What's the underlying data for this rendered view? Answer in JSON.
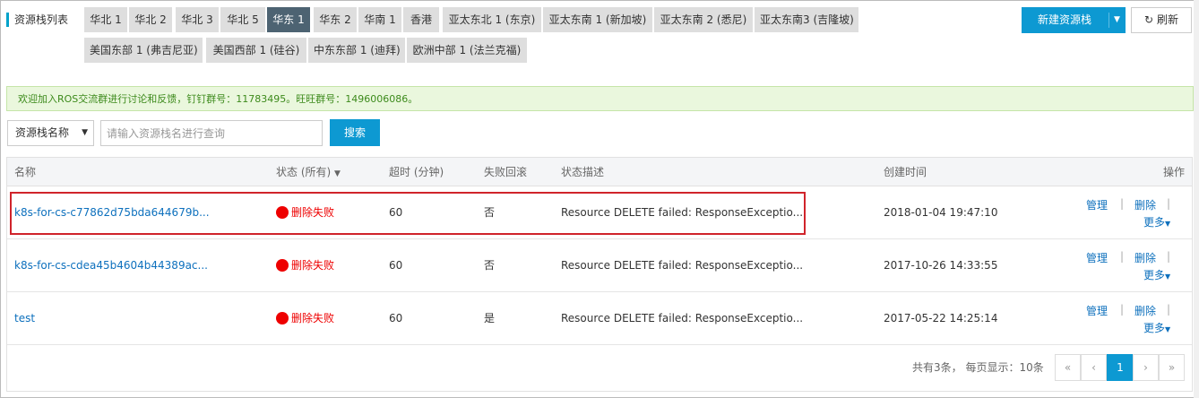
{
  "header": {
    "title": "资源栈列表"
  },
  "regions": [
    {
      "label": "华北 1",
      "active": false
    },
    {
      "label": "华北 2",
      "active": false
    },
    {
      "label": "华北 3",
      "active": false
    },
    {
      "label": "华北 5",
      "active": false
    },
    {
      "label": "华东 1",
      "active": true
    },
    {
      "label": "华东 2",
      "active": false
    },
    {
      "label": "华南 1",
      "active": false
    },
    {
      "label": "香港",
      "active": false
    },
    {
      "label": "亚太东北 1 (东京)",
      "active": false
    },
    {
      "label": "亚太东南 1 (新加坡)",
      "active": false
    },
    {
      "label": "亚太东南 2 (悉尼)",
      "active": false
    },
    {
      "label": "亚太东南3 (吉隆坡)",
      "active": false
    },
    {
      "label": "美国东部 1 (弗吉尼亚)",
      "active": false
    },
    {
      "label": "美国西部 1 (硅谷)",
      "active": false
    },
    {
      "label": "中东东部 1 (迪拜)",
      "active": false
    },
    {
      "label": "欧洲中部 1 (法兰克福)",
      "active": false
    }
  ],
  "toolbar": {
    "new_stack_label": "新建资源栈",
    "refresh_label": "刷新"
  },
  "notice": "欢迎加入ROS交流群进行讨论和反馈，钉钉群号：11783495。旺旺群号：1496006086。",
  "search": {
    "field_select": "资源栈名称",
    "placeholder": "请输入资源栈名进行查询",
    "button_label": "搜索"
  },
  "table": {
    "headers": {
      "name": "名称",
      "status": "状态 (所有)",
      "timeout": "超时 (分钟)",
      "rollback": "失败回滚",
      "desc": "状态描述",
      "created": "创建时间",
      "ops": "操作"
    },
    "rows": [
      {
        "name": "k8s-for-cs-c77862d75bda644679b...",
        "status": "删除失败",
        "timeout": "60",
        "rollback": "否",
        "desc": "Resource DELETE failed: ResponseExceptio...",
        "created": "2018-01-04 19:47:10",
        "manage": "管理",
        "delete": "删除",
        "more": "更多"
      },
      {
        "name": "k8s-for-cs-cdea45b4604b44389ac...",
        "status": "删除失败",
        "timeout": "60",
        "rollback": "否",
        "desc": "Resource DELETE failed: ResponseExceptio...",
        "created": "2017-10-26 14:33:55",
        "manage": "管理",
        "delete": "删除",
        "more": "更多"
      },
      {
        "name": "test",
        "status": "删除失败",
        "timeout": "60",
        "rollback": "是",
        "desc": "Resource DELETE failed: ResponseExceptio...",
        "created": "2017-05-22 14:25:14",
        "manage": "管理",
        "delete": "删除",
        "more": "更多"
      }
    ]
  },
  "pagination": {
    "info": "共有3条， 每页显示：10条",
    "first": "«",
    "prev": "‹",
    "current": "1",
    "next": "›",
    "last": "»"
  },
  "colors": {
    "accent": "#0d99d2",
    "error": "#ee0000",
    "link": "#0d70bd",
    "highlight": "#d0242b"
  }
}
